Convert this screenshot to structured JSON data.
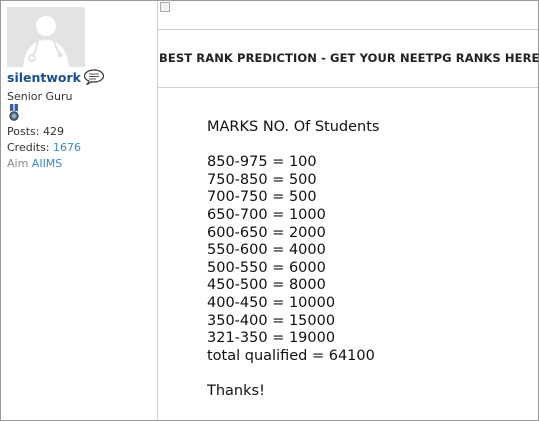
{
  "user": {
    "username": "silentwork",
    "rank": "Senior Guru",
    "posts_label": "Posts:",
    "posts": "429",
    "credits_label": "Credits:",
    "credits": "1676",
    "aim_label": "Aim",
    "aim": "AIIMS"
  },
  "post": {
    "title": "BEST RANK PREDICTION - GET YOUR NEETPG RANKS HERE!",
    "header": "MARKS NO. Of Students",
    "lines": [
      "850-975 = 100",
      "750-850 = 500",
      "700-750 = 500",
      "650-700 = 1000",
      "600-650 = 2000",
      "550-600 = 4000",
      "500-550 = 6000",
      "450-500 = 8000",
      "400-450 = 10000",
      "350-400 = 15000",
      "321-350 = 19000",
      "total qualified = 64100"
    ],
    "closing": "Thanks!"
  },
  "colors": {
    "username": "#1a4f8b",
    "link": "#3b87c9",
    "divider": "#cfcfcf"
  },
  "icons": [
    "doctor-avatar-icon",
    "chat-bubble-icon",
    "medal-icon",
    "broken-image-icon"
  ]
}
